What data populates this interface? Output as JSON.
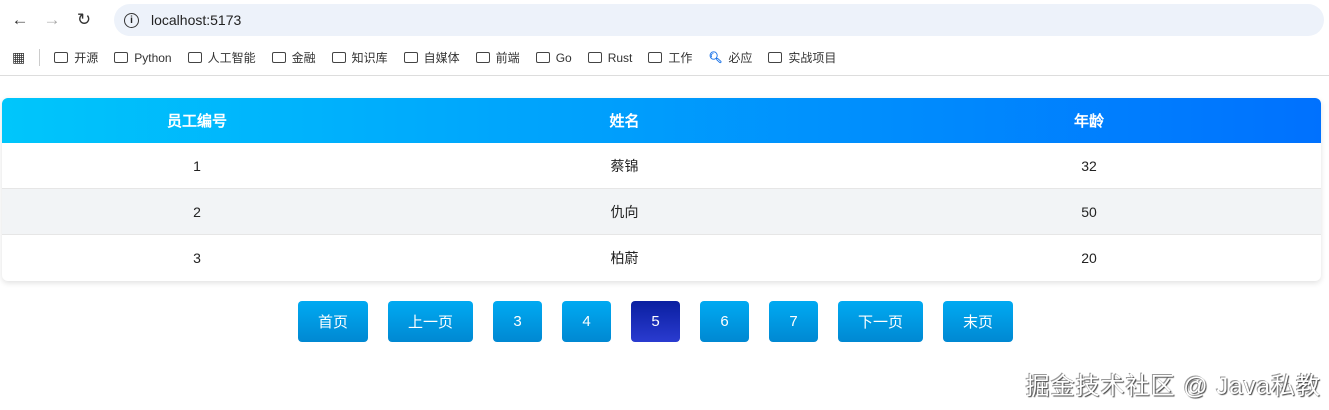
{
  "browser": {
    "url": "localhost:5173"
  },
  "bookmarks": [
    {
      "label": "开源",
      "icon": "folder-icon"
    },
    {
      "label": "Python",
      "icon": "folder-icon"
    },
    {
      "label": "人工智能",
      "icon": "folder-icon"
    },
    {
      "label": "金融",
      "icon": "folder-icon"
    },
    {
      "label": "知识库",
      "icon": "folder-icon"
    },
    {
      "label": "自媒体",
      "icon": "folder-icon"
    },
    {
      "label": "前端",
      "icon": "folder-icon"
    },
    {
      "label": "Go",
      "icon": "folder-icon"
    },
    {
      "label": "Rust",
      "icon": "folder-icon"
    },
    {
      "label": "工作",
      "icon": "folder-icon"
    },
    {
      "label": "必应",
      "icon": "search-icon"
    },
    {
      "label": "实战项目",
      "icon": "folder-icon"
    }
  ],
  "table": {
    "headers": [
      "员工编号",
      "姓名",
      "年龄"
    ],
    "rows": [
      [
        "1",
        "蔡锦",
        "32"
      ],
      [
        "2",
        "仇向",
        "50"
      ],
      [
        "3",
        "柏蔚",
        "20"
      ]
    ]
  },
  "pagination": {
    "first": "首页",
    "prev": "上一页",
    "pages": [
      "3",
      "4",
      "5",
      "6",
      "7"
    ],
    "current": "5",
    "next": "下一页",
    "last": "末页"
  },
  "watermark": "掘金技术社区 @ Java私教"
}
